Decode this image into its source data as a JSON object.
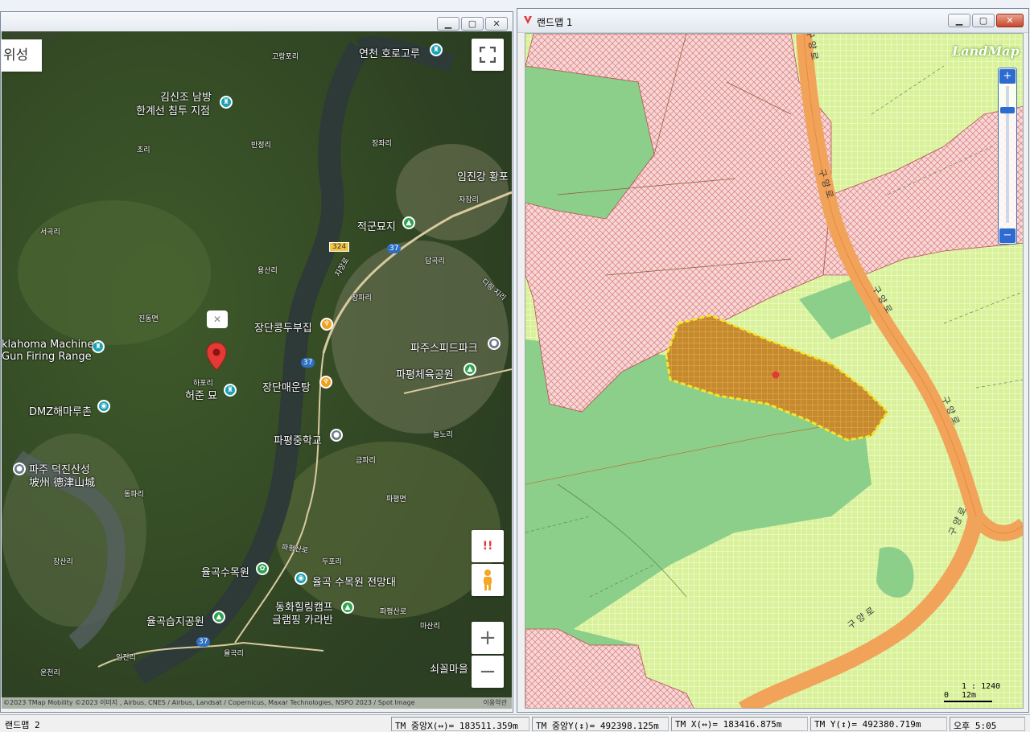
{
  "left_window": {
    "map_type_button": "위성",
    "attribution": "©2023 TMap Mobility ©2023 이미지 , Airbus, CNES / Airbus, Landsat / Copernicus, Maxar Technologies, NSPO 2023 / Spot Image",
    "attribution_link": "이용약관",
    "zoom_in": "+",
    "zoom_out": "−",
    "alert_btn": "!!",
    "labels": {
      "p1": "연천 호로고루",
      "p2": "고랑포리",
      "p3": "김신조 남방",
      "p3b": "한계선 침투 지점",
      "p4": "초리",
      "p5": "반정리",
      "p6": "장좌리",
      "p7": "임진강 황포",
      "p8": "자장리",
      "p9": "적군묘지",
      "p10": "서곡리",
      "p11": "324",
      "p12": "37",
      "p13": "답곡리",
      "p14": "용산리",
      "p15": "장파리",
      "p16": "디링 지리",
      "p17": "진동면",
      "p18": "장단콩두부집",
      "p19": "klahoma Machine",
      "p19b": "Gun Firing Range",
      "p20": "파주스피드파크",
      "p21": "하포리",
      "p22": "허준 묘",
      "p23": "37",
      "p24": "장단매운탕",
      "p25": "파평체육공원",
      "p26": "DMZ해마루촌",
      "p27": "파평중학교",
      "p28": "늘노리",
      "p29": "금파리",
      "p30": "파주 덕진산성",
      "p30b": "坡州 德津山城",
      "p31": "동파리",
      "p32": "파평면",
      "p33": "장산리",
      "p34": "파평산로",
      "p35": "두포리",
      "p36": "율곡수목원",
      "p37": "율곡 수목원 전망대",
      "p38": "동화힐링캠프",
      "p38b": "글램핑 카라반",
      "p39": "율곡습지공원",
      "p40": "37",
      "p41": "파평산로",
      "p42": "마산리",
      "p43": "임진리",
      "p44": "율곡리",
      "p45": "운천리",
      "p46": "쇠꼴마을",
      "p47": "자장로"
    }
  },
  "right_window": {
    "title": "랜드맵 1",
    "logo": "LandMap",
    "scale_text": "1 : 1240",
    "scale_bar_left": "0",
    "scale_bar_right": "12m",
    "roads": [
      "구 양 로",
      "구 양 로",
      "구 양 로",
      "구 양 로",
      "구 양 로",
      "구 양 로"
    ]
  },
  "statusbar": {
    "app": "랜드맵 2",
    "tm_center_x": "TM 중앙X(↔)= 183511.359m",
    "tm_center_y": "TM 중앙Y(↕)= 492398.125m",
    "tm_x": "TM X(↔)= 183416.875m",
    "tm_y": "TM Y(↕)= 492380.719m",
    "clock": "오후 5:05"
  },
  "colors": {
    "pink_zone": "#f4c9c9",
    "green_zone": "#8fd18f",
    "grid_zone": "#d9f29a",
    "road": "#f4a15d",
    "selected_parcel": "#c98a2a"
  }
}
